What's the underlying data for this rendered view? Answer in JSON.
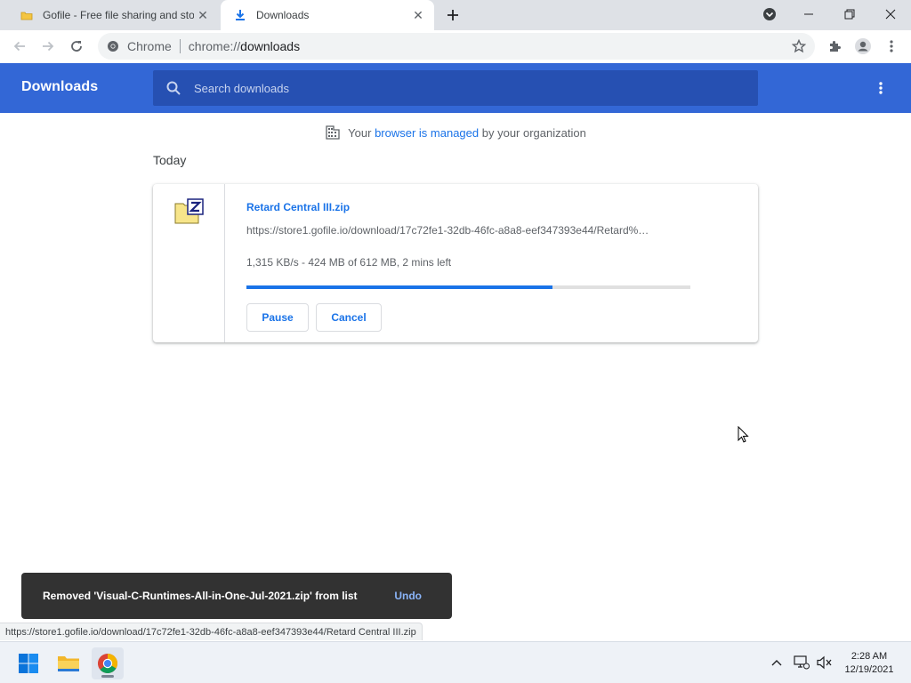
{
  "tabs": [
    {
      "title": "Gofile - Free file sharing and stor",
      "favicon": "gofile-folder-icon",
      "active": false
    },
    {
      "title": "Downloads",
      "favicon": "download-icon",
      "active": true
    }
  ],
  "toolbar": {
    "omnibox_chip": "Chrome",
    "url_scheme": "chrome://",
    "url_host": "downloads"
  },
  "header": {
    "title": "Downloads",
    "search_placeholder": "Search downloads"
  },
  "managed": {
    "prefix": "Your",
    "link": "browser is managed",
    "suffix": "by your organization"
  },
  "section_label": "Today",
  "download": {
    "filename": "Retard Central III.zip",
    "url": "https://store1.gofile.io/download/17c72fe1-32db-46fc-a8a8-eef347393e44/Retard%…",
    "status": "1,315 KB/s - 424 MB of 612 MB, 2 mins left",
    "progress_fraction": 0.69,
    "pause_label": "Pause",
    "cancel_label": "Cancel"
  },
  "toast": {
    "message": "Removed 'Visual-C-Runtimes-All-in-One-Jul-2021.zip' from list",
    "undo_label": "Undo"
  },
  "status_bubble": "https://store1.gofile.io/download/17c72fe1-32db-46fc-a8a8-eef347393e44/Retard Central III.zip",
  "taskbar": {
    "apps": [
      "windows-start-icon",
      "file-explorer-icon",
      "chrome-icon"
    ],
    "time": "2:28 AM",
    "date": "12/19/2021"
  },
  "colors": {
    "accent": "#1a73e8",
    "header_bg": "#3367d6",
    "search_bg": "#2650b2",
    "toast_bg": "#323232"
  }
}
